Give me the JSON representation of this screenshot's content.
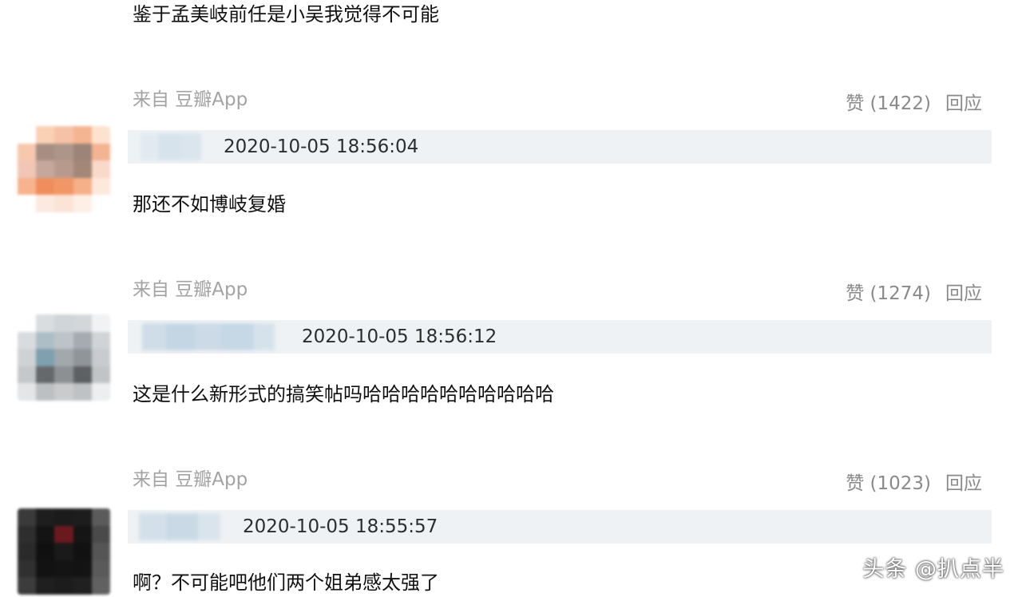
{
  "top_comment": {
    "text": "鉴于孟美岐前任是小吴我觉得不可能",
    "source": "来自 豆瓣App",
    "likes": "赞 (1422)",
    "reply": "回应"
  },
  "comments": [
    {
      "timestamp": "2020-10-05 18:56:04",
      "text": "那还不如博岐复婚",
      "source": "来自 豆瓣App",
      "likes": "赞 (1274)",
      "reply": "回应"
    },
    {
      "timestamp": "2020-10-05 18:56:12",
      "text": "这是什么新形式的搞笑帖吗哈哈哈哈哈哈哈哈哈哈",
      "source": "来自 豆瓣App",
      "likes": "赞 (1023)",
      "reply": "回应"
    },
    {
      "timestamp": "2020-10-05 18:55:57",
      "text": "啊？不可能吧他们两个姐弟感太强了"
    }
  ],
  "watermark": "头条 @扒点半",
  "colors": {
    "name_bar": "#eef2f5",
    "source_text": "#a3a3a3",
    "action_text": "#8a8a8a"
  }
}
